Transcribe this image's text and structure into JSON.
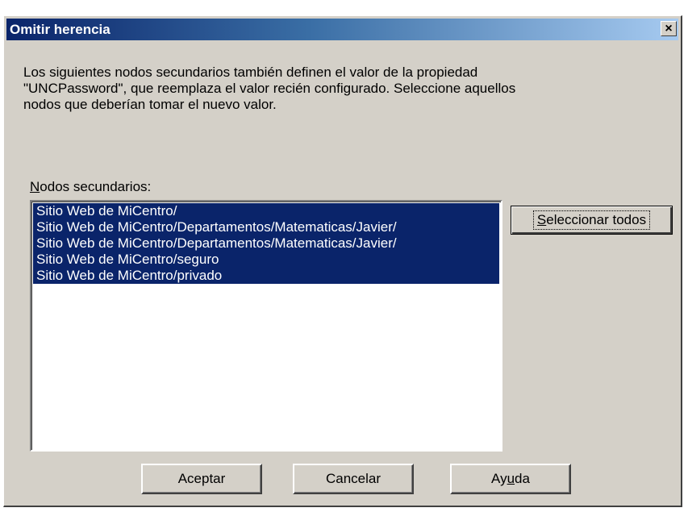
{
  "window": {
    "title": "Omitir herencia",
    "close_label": "×"
  },
  "content": {
    "description_line1": "Los siguientes nodos secundarios también definen el valor de la propiedad",
    "description_line2": "\"UNCPassword\", que reemplaza el valor recién configurado. Seleccione aquellos",
    "description_line3": "nodos que deberían tomar el nuevo valor.",
    "nodes_label_accel": "N",
    "nodes_label_rest": "odos secundarios:"
  },
  "nodes": {
    "items": [
      {
        "label": "Sitio Web de MiCentro/",
        "selected": true
      },
      {
        "label": "Sitio Web de MiCentro/Departamentos/Matematicas/Javier/",
        "selected": true
      },
      {
        "label": "Sitio Web de MiCentro/Departamentos/Matematicas/Javier/",
        "selected": true
      },
      {
        "label": "Sitio Web de MiCentro/seguro",
        "selected": true
      },
      {
        "label": "Sitio Web de MiCentro/privado",
        "selected": true
      }
    ]
  },
  "buttons": {
    "select_all_accel": "S",
    "select_all_rest": "eleccionar todos",
    "ok_label": "Aceptar",
    "cancel_label": "Cancelar",
    "help_pre": "Ay",
    "help_accel": "u",
    "help_post": "da"
  },
  "colors": {
    "selection_bg": "#0a246a",
    "dialog_bg": "#d4d0c8",
    "titlebar_start": "#0a246a",
    "titlebar_end": "#a6caf0"
  }
}
